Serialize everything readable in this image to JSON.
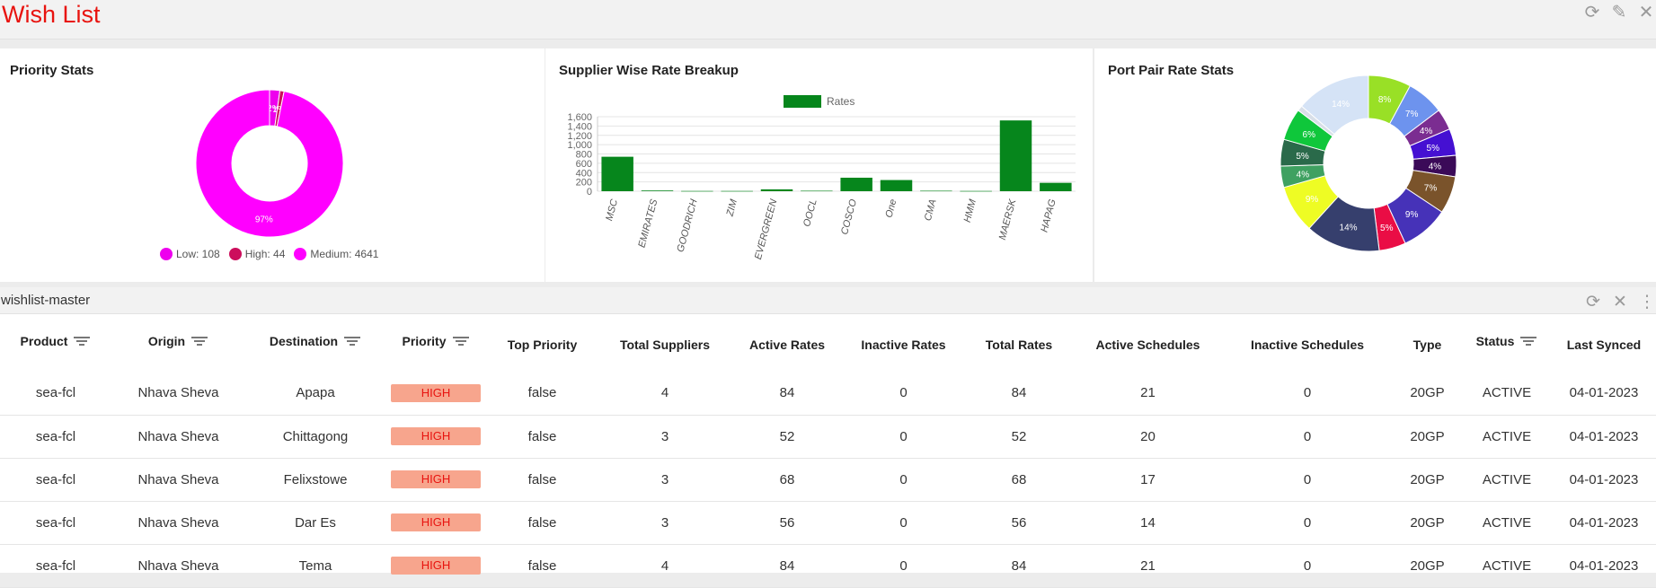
{
  "page": {
    "title": "Wish List"
  },
  "colors": {
    "accent": "#e8130f",
    "bar": "#06861c",
    "badge_bg": "#f7a58d"
  },
  "priority_stats": {
    "title": "Priority Stats",
    "chart_data": {
      "type": "pie",
      "slices": [
        {
          "label": "Low",
          "value": 108,
          "color": "#ee00ee",
          "pct_label": "2%"
        },
        {
          "label": "High",
          "value": 44,
          "color": "#cc0e5c",
          "pct_label": "1%"
        },
        {
          "label": "Medium",
          "value": 4641,
          "color": "#ff00ff",
          "pct_label": "97%"
        }
      ]
    },
    "legend": [
      "Low: 108",
      "High: 44",
      "Medium: 4641"
    ]
  },
  "supplier_breakup": {
    "title": "Supplier Wise Rate Breakup",
    "chart_data": {
      "type": "bar",
      "categories": [
        "MSC",
        "EMIRATES",
        "GOODRICH",
        "ZIM",
        "EVERGREEN",
        "OOCL",
        "COSCO",
        "One",
        "CMA",
        "HMM",
        "MAERSK",
        "HAPAG"
      ],
      "series": [
        {
          "name": "Rates",
          "values": [
            740,
            15,
            5,
            5,
            40,
            10,
            290,
            240,
            10,
            5,
            1520,
            180
          ]
        }
      ],
      "ylim": [
        0,
        1600
      ],
      "yticks": [
        "0",
        "200",
        "400",
        "600",
        "800",
        "1,000",
        "1,200",
        "1,400",
        "1,600"
      ],
      "legend": "top",
      "grid": true
    }
  },
  "port_pair_stats": {
    "title": "Port Pair Rate Stats",
    "chart_data": {
      "type": "pie",
      "slices": [
        {
          "value": 8,
          "color": "#99e026",
          "pct_label": "8%"
        },
        {
          "value": 7,
          "color": "#6d93ee",
          "pct_label": "7%"
        },
        {
          "value": 4,
          "color": "#7b2d91",
          "pct_label": "4%"
        },
        {
          "value": 5,
          "color": "#4510d2",
          "pct_label": "5%"
        },
        {
          "value": 4,
          "color": "#3b0a58",
          "pct_label": "4%"
        },
        {
          "value": 7,
          "color": "#7a532b",
          "pct_label": "7%"
        },
        {
          "value": 9,
          "color": "#4632b8",
          "pct_label": "9%"
        },
        {
          "value": 5,
          "color": "#ea0d45",
          "pct_label": "5%"
        },
        {
          "value": 14,
          "color": "#363f6d",
          "pct_label": "14%"
        },
        {
          "value": 9,
          "color": "#eefc24",
          "pct_label": "9%"
        },
        {
          "value": 4,
          "color": "#3fa161",
          "pct_label": "4%"
        },
        {
          "value": 5,
          "color": "#2a6a4a",
          "pct_label": "5%"
        },
        {
          "value": 6,
          "color": "#0fc73b",
          "pct_label": "6%"
        },
        {
          "value": 1,
          "color": "#d8dfe8",
          "pct_label": ""
        },
        {
          "value": 14,
          "color": "#d5e3f6",
          "pct_label": "14%"
        }
      ]
    }
  },
  "grid": {
    "title": "wishlist-master",
    "columns": [
      "Product",
      "Origin",
      "Destination",
      "Priority",
      "Top Priority",
      "Total Suppliers",
      "Active Rates",
      "Inactive Rates",
      "Total Rates",
      "Active Schedules",
      "Inactive Schedules",
      "Type",
      "Status",
      "Last Synced"
    ],
    "rows": [
      [
        "sea-fcl",
        "Nhava Sheva",
        "Apapa",
        "HIGH",
        "false",
        "4",
        "84",
        "0",
        "84",
        "21",
        "0",
        "20GP",
        "ACTIVE",
        "04-01-2023"
      ],
      [
        "sea-fcl",
        "Nhava Sheva",
        "Chittagong",
        "HIGH",
        "false",
        "3",
        "52",
        "0",
        "52",
        "20",
        "0",
        "20GP",
        "ACTIVE",
        "04-01-2023"
      ],
      [
        "sea-fcl",
        "Nhava Sheva",
        "Felixstowe",
        "HIGH",
        "false",
        "3",
        "68",
        "0",
        "68",
        "17",
        "0",
        "20GP",
        "ACTIVE",
        "04-01-2023"
      ],
      [
        "sea-fcl",
        "Nhava Sheva",
        "Dar Es",
        "HIGH",
        "false",
        "3",
        "56",
        "0",
        "56",
        "14",
        "0",
        "20GP",
        "ACTIVE",
        "04-01-2023"
      ],
      [
        "sea-fcl",
        "Nhava Sheva",
        "Tema",
        "HIGH",
        "false",
        "4",
        "84",
        "0",
        "84",
        "21",
        "0",
        "20GP",
        "ACTIVE",
        "04-01-2023"
      ]
    ]
  }
}
